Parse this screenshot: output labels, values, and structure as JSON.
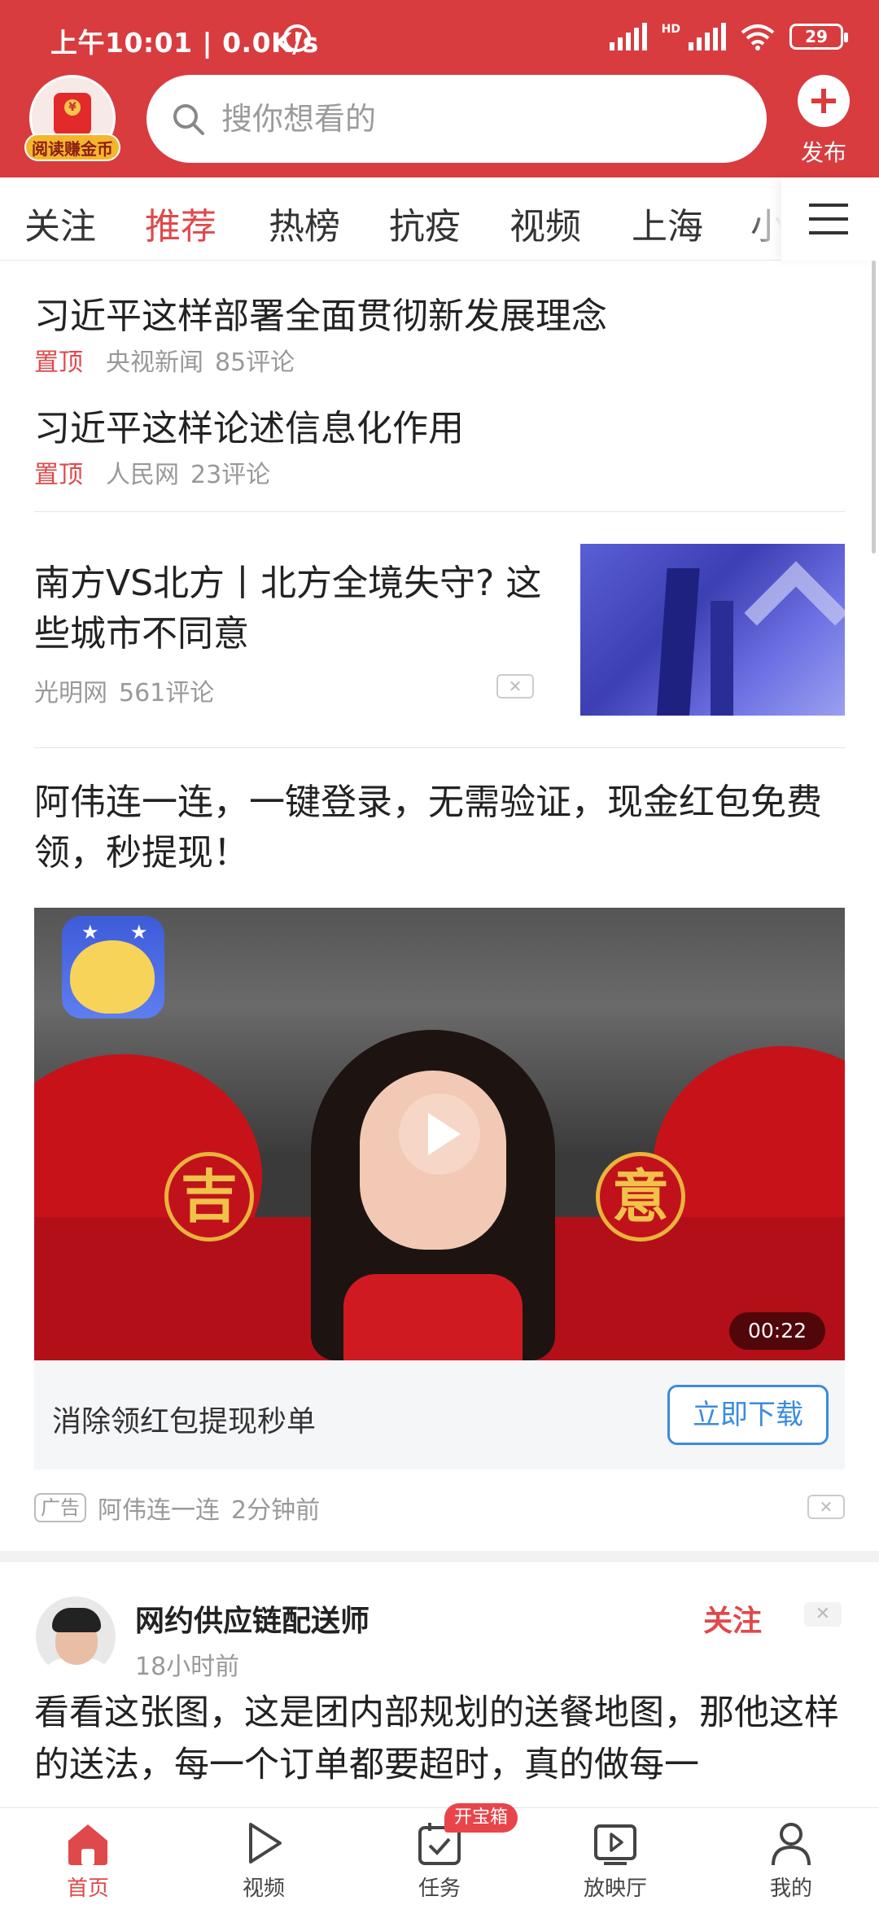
{
  "status_bar": {
    "time": "上午10:01 | 0.0K/s",
    "hd": "HD",
    "battery": "29"
  },
  "header": {
    "coin_label": "阅读赚金币",
    "search_placeholder": "搜你想看的",
    "publish_label": "发布"
  },
  "tabs": [
    "关注",
    "推荐",
    "热榜",
    "抗疫",
    "视频",
    "上海",
    "小"
  ],
  "feed": {
    "pinned": [
      {
        "title": "习近平这样部署全面贯彻新发展理念",
        "tag": "置顶",
        "source": "央视新闻",
        "comments": "85评论"
      },
      {
        "title": "习近平这样论述信息化作用",
        "tag": "置顶",
        "source": "人民网",
        "comments": "23评论"
      }
    ],
    "article": {
      "title": "南方VS北方丨北方全境失守? 这些城市不同意",
      "source": "光明网",
      "comments": "561评论"
    },
    "ad": {
      "title": "阿伟连一连，一键登录，无需验证，现金红包免费领，秒提现！",
      "video_left_char": "吉",
      "video_right_char": "意",
      "duration": "00:22",
      "bar_text": "消除领红包提现秒单",
      "download_label": "立即下载",
      "tag": "广告",
      "advertiser": "阿伟连一连",
      "time": "2分钟前"
    },
    "post": {
      "author": "网约供应链配送师",
      "time": "18小时前",
      "follow_label": "关注",
      "text": "看看这张图，这是团内部规划的送餐地图，那他这样的送法，每一个订单都要超时，真的做每一"
    }
  },
  "bottom_nav": {
    "items": [
      "首页",
      "视频",
      "任务",
      "放映厅",
      "我的"
    ],
    "task_badge": "开宝箱"
  },
  "colors": {
    "brand_red": "#d83c3f",
    "accent_red": "#e0494b",
    "link_blue": "#3a8be0"
  },
  "close_glyph": "✕"
}
